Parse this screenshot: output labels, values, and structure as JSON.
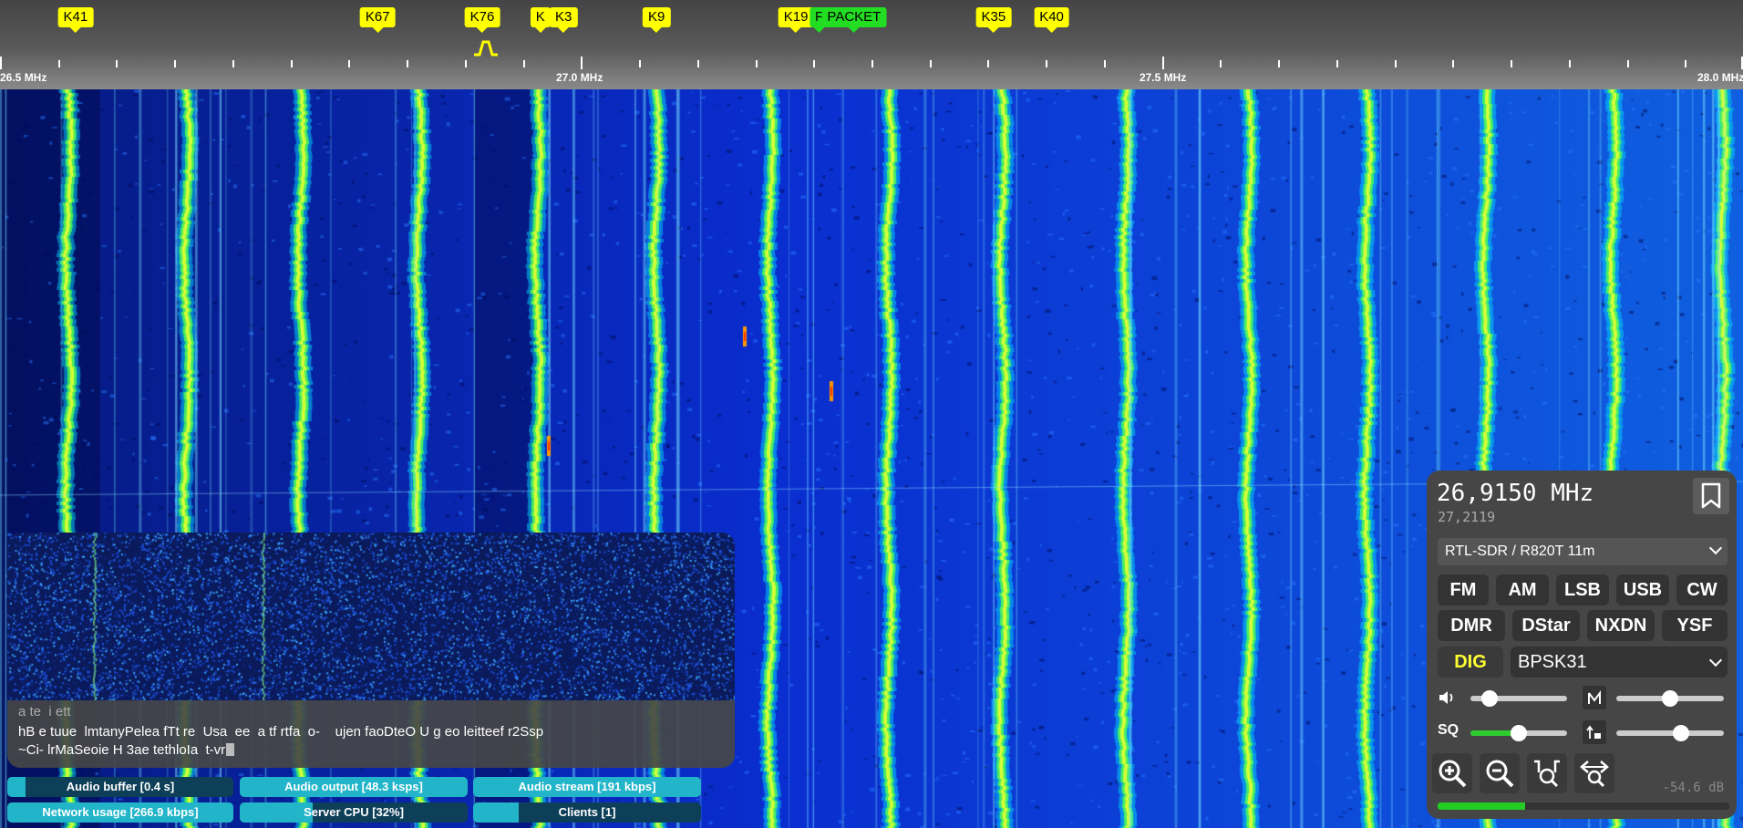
{
  "scale": {
    "labels": [
      "26.5 MHz",
      "27.0 MHz",
      "27.5 MHz",
      "28.0 MHz"
    ],
    "bookmarks": [
      {
        "label": "K41",
        "freq_mhz": 26.565,
        "color": "yellow"
      },
      {
        "label": "K67",
        "freq_mhz": 26.825,
        "color": "yellow"
      },
      {
        "label": "K76",
        "freq_mhz": 26.915,
        "color": "yellow"
      },
      {
        "label": "K",
        "freq_mhz": 26.965,
        "color": "yellow"
      },
      {
        "label": "K3",
        "freq_mhz": 26.985,
        "color": "yellow"
      },
      {
        "label": "K9",
        "freq_mhz": 27.065,
        "color": "yellow"
      },
      {
        "label": "K19",
        "freq_mhz": 27.185,
        "color": "yellow"
      },
      {
        "label": "F",
        "freq_mhz": 27.205,
        "color": "green"
      },
      {
        "label": "PACKET",
        "freq_mhz": 27.235,
        "color": "green"
      },
      {
        "label": "K35",
        "freq_mhz": 27.355,
        "color": "yellow"
      },
      {
        "label": "K40",
        "freq_mhz": 27.405,
        "color": "yellow"
      }
    ]
  },
  "decoder": {
    "status": "a te  i ett",
    "line1": "hB e tuue  lmtanyPelea fTt re  Usa  ee  a tf rtfa  o-    ujen faoDteO U g eo leitteef r2Ssp",
    "line2": "~Ci- lrMaSeoie H 3ae tethloIa  t-vr"
  },
  "status_bars": [
    {
      "label": "Audio buffer [0.4 s]",
      "level": 0.08
    },
    {
      "label": "Audio output [48.3 ksps]",
      "level": 1.0
    },
    {
      "label": "Audio stream [191 kbps]",
      "level": 1.0
    },
    {
      "label": "Network usage [266.9 kbps]",
      "level": 1.0
    },
    {
      "label": "Server CPU [32%]",
      "level": 0.32
    },
    {
      "label": "Clients [1]",
      "level": 0.2
    }
  ],
  "receiver": {
    "frequency": "26,9150 MHz",
    "offset": "27,2119",
    "profile": "RTL-SDR / R820T 11m",
    "modes_row1": [
      "FM",
      "AM",
      "LSB",
      "USB",
      "CW"
    ],
    "modes_row2": [
      "DMR",
      "DStar",
      "NXDN",
      "YSF"
    ],
    "dig_label": "DIG",
    "digimode": "BPSK31",
    "sq_label": "SQ",
    "volume_level": 0.2,
    "nr_level": 0.5,
    "squelch_level": 0.5,
    "agc_level": 0.6,
    "smeter_level": 0.3,
    "db_readout": "-54.6 dB"
  },
  "colors": {
    "bookmark": "#ffff00",
    "bookmark_digital": "#22dd22",
    "accent": "#22b5c9",
    "smeter": "#22cc22"
  }
}
